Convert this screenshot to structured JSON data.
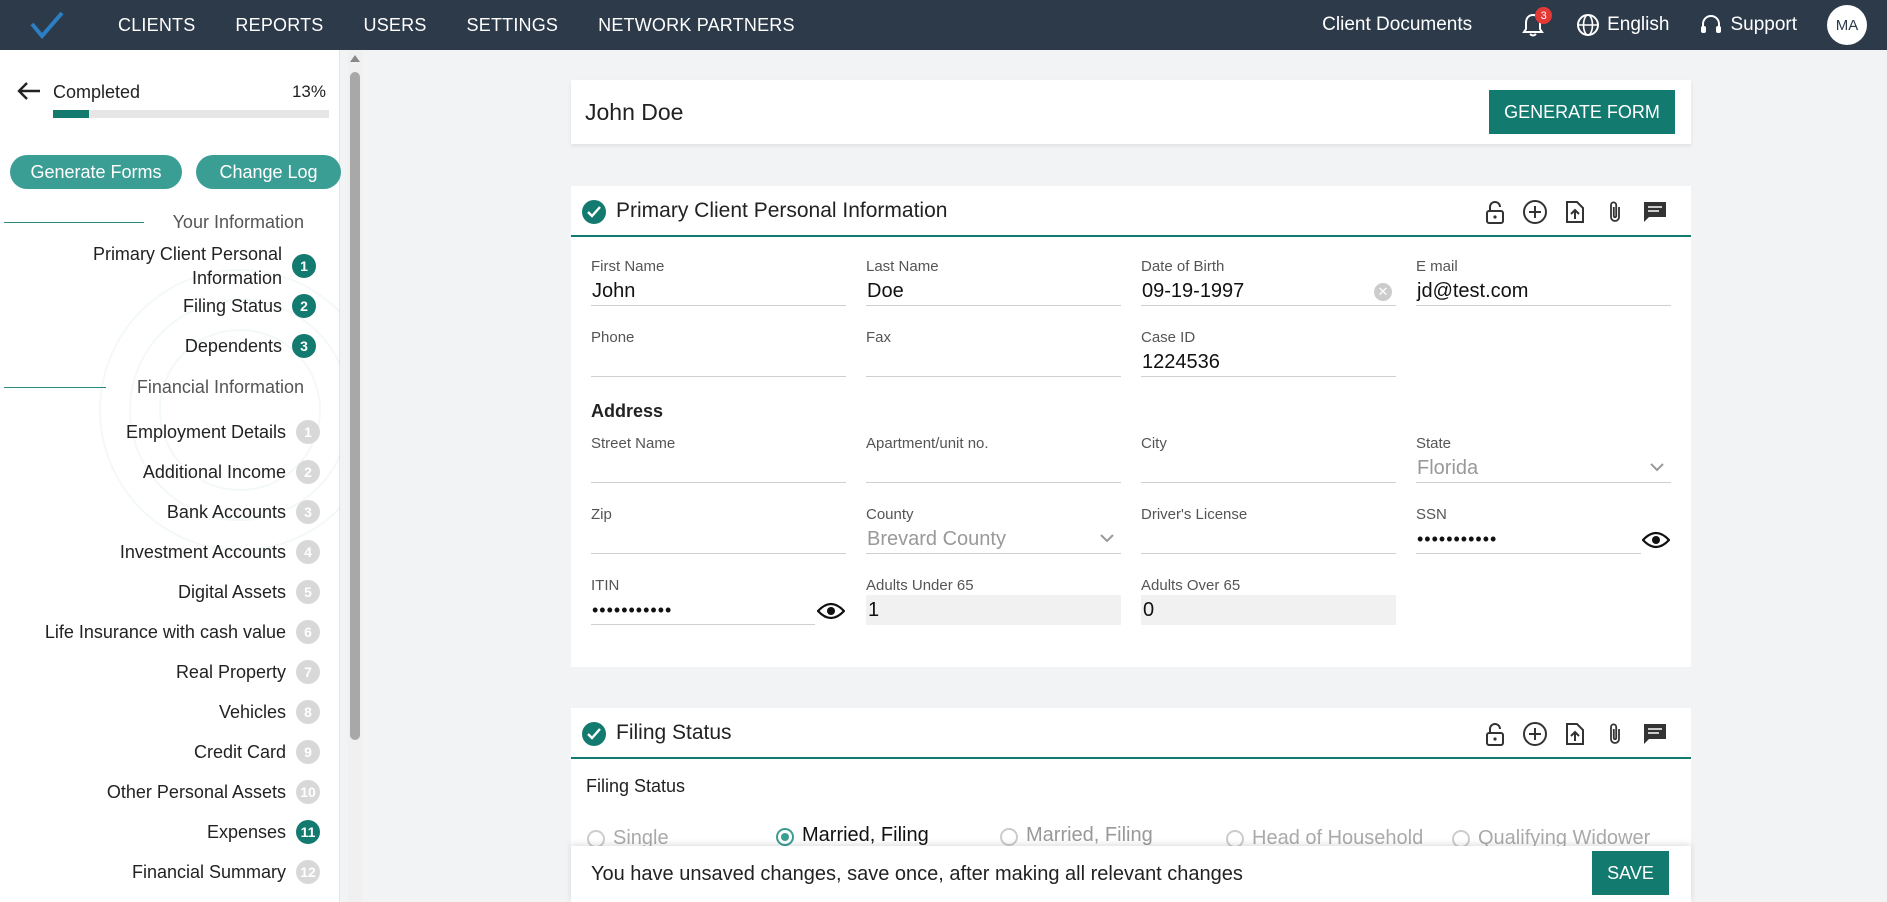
{
  "nav": {
    "items": [
      "CLIENTS",
      "REPORTS",
      "USERS",
      "SETTINGS",
      "NETWORK PARTNERS"
    ],
    "client_documents": "Client Documents",
    "notification_count": "3",
    "language": "English",
    "support": "Support",
    "avatar_initials": "MA"
  },
  "sidebar": {
    "progress_label": "Completed",
    "progress_pct": "13%",
    "progress_value": 0.13,
    "generate_forms": "Generate Forms",
    "change_log": "Change Log",
    "your_info_heading": "Your Information",
    "your_info_items": [
      {
        "label_line1": "Primary Client Personal",
        "label_line2": "Information",
        "num": "1",
        "status": "done"
      },
      {
        "label": "Filing Status",
        "num": "2",
        "status": "done"
      },
      {
        "label": "Dependents",
        "num": "3",
        "status": "done"
      }
    ],
    "financial_heading": "Financial Information",
    "financial_items": [
      {
        "label": "Employment Details",
        "num": "1",
        "status": "todo"
      },
      {
        "label": "Additional Income",
        "num": "2",
        "status": "todo"
      },
      {
        "label": "Bank Accounts",
        "num": "3",
        "status": "todo"
      },
      {
        "label": "Investment Accounts",
        "num": "4",
        "status": "todo"
      },
      {
        "label": "Digital Assets",
        "num": "5",
        "status": "todo"
      },
      {
        "label": "Life Insurance with cash value",
        "num": "6",
        "status": "todo"
      },
      {
        "label": "Real Property",
        "num": "7",
        "status": "todo"
      },
      {
        "label": "Vehicles",
        "num": "8",
        "status": "todo"
      },
      {
        "label": "Credit Card",
        "num": "9",
        "status": "todo"
      },
      {
        "label": "Other Personal Assets",
        "num": "10",
        "status": "todo"
      },
      {
        "label": "Expenses",
        "num": "11",
        "status": "done"
      },
      {
        "label": "Financial Summary",
        "num": "12",
        "status": "todo"
      }
    ]
  },
  "client": {
    "name": "John Doe",
    "generate_form": "GENERATE FORM"
  },
  "personal_info": {
    "title": "Primary Client Personal Information",
    "first_name": {
      "label": "First Name",
      "value": "John"
    },
    "last_name": {
      "label": "Last Name",
      "value": "Doe"
    },
    "dob": {
      "label": "Date of Birth",
      "value": "09-19-1997"
    },
    "email": {
      "label": "E mail",
      "value": "jd@test.com"
    },
    "phone": {
      "label": "Phone",
      "value": ""
    },
    "fax": {
      "label": "Fax",
      "value": ""
    },
    "case_id": {
      "label": "Case ID",
      "value": "1224536"
    },
    "address_heading": "Address",
    "street": {
      "label": "Street Name",
      "value": ""
    },
    "apt": {
      "label": "Apartment/unit no.",
      "value": ""
    },
    "city": {
      "label": "City",
      "value": ""
    },
    "state": {
      "label": "State",
      "value": "Florida"
    },
    "zip": {
      "label": "Zip",
      "value": ""
    },
    "county": {
      "label": "County",
      "value": "Brevard County"
    },
    "drivers_license": {
      "label": "Driver's License",
      "value": ""
    },
    "ssn": {
      "label": "SSN",
      "value": "•••••••••••"
    },
    "itin": {
      "label": "ITIN",
      "value": "•••••••••••"
    },
    "adults_under_65": {
      "label": "Adults Under 65",
      "value": "1"
    },
    "adults_over_65": {
      "label": "Adults Over 65",
      "value": "0"
    }
  },
  "filing_status": {
    "title": "Filing Status",
    "field_label": "Filing Status",
    "options": [
      "Single",
      "Married, Filing",
      "Married, Filing",
      "Head of Household",
      "Qualifying Widower"
    ],
    "selected_index": 1
  },
  "unsaved": {
    "message": "You have unsaved changes, save once, after making all relevant changes",
    "save": "SAVE"
  },
  "colors": {
    "nav_bg": "#2d3a4a",
    "accent": "#137a70",
    "accent_light": "#3b9e94"
  }
}
